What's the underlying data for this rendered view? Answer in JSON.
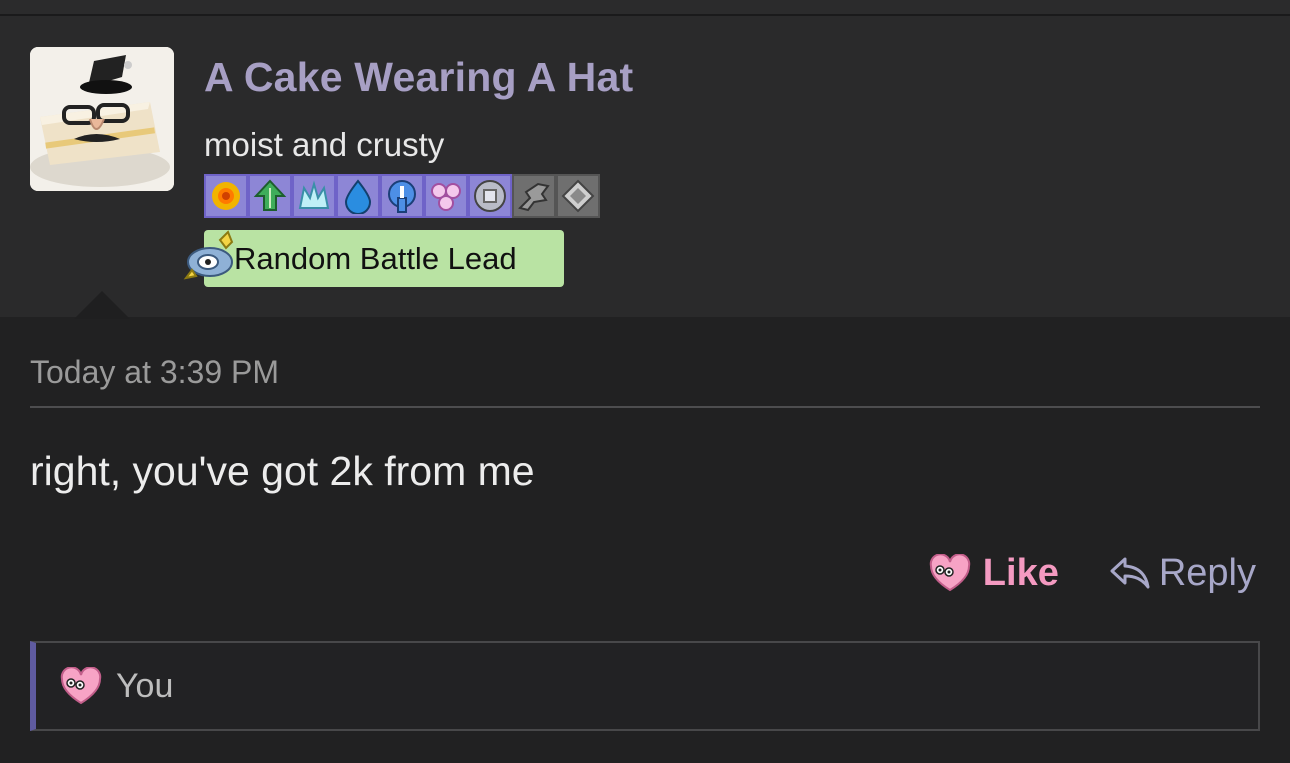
{
  "post": {
    "username": "A Cake Wearing A Hat",
    "user_title": "moist and crusty",
    "badge_banner": "Random Battle Lead",
    "timestamp": "Today at 3:39 PM",
    "message": "right, you've got 2k from me",
    "like_label": "Like",
    "reply_label": "Reply",
    "liked_by": "You"
  },
  "badges": [
    {
      "icon": "sun-badge-icon",
      "style": "purple"
    },
    {
      "icon": "leaf-badge-icon",
      "style": "purple"
    },
    {
      "icon": "ice-badge-icon",
      "style": "purple"
    },
    {
      "icon": "water-drop-badge-icon",
      "style": "purple"
    },
    {
      "icon": "ghost-badge-icon",
      "style": "purple"
    },
    {
      "icon": "fairy-badge-icon",
      "style": "purple"
    },
    {
      "icon": "steel-ball-badge-icon",
      "style": "purple"
    },
    {
      "icon": "dragon-badge-icon",
      "style": "gray"
    },
    {
      "icon": "diamond-badge-icon",
      "style": "gray"
    }
  ],
  "colors": {
    "username": "#a79fc4",
    "like": "#f49ac1",
    "badge_banner_bg": "#b9e3a3",
    "likes_accent": "#5f5ba0"
  }
}
